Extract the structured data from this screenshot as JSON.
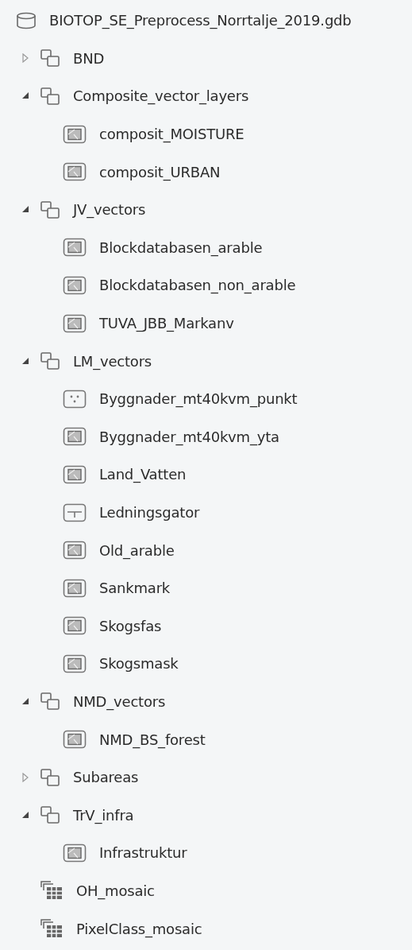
{
  "tree": [
    {
      "label": "BIOTOP_SE_Preprocess_Norrtalje_2019.gdb",
      "kind": "geodatabase",
      "children": [
        {
          "label": "BND",
          "kind": "dataset",
          "expanded": false
        },
        {
          "label": "Composite_vector_layers",
          "kind": "dataset",
          "expanded": true,
          "children": [
            {
              "label": "composit_MOISTURE",
              "kind": "polygon"
            },
            {
              "label": "composit_URBAN",
              "kind": "polygon"
            }
          ]
        },
        {
          "label": "JV_vectors",
          "kind": "dataset",
          "expanded": true,
          "children": [
            {
              "label": "Blockdatabasen_arable",
              "kind": "polygon"
            },
            {
              "label": "Blockdatabasen_non_arable",
              "kind": "polygon"
            },
            {
              "label": "TUVA_JBB_Markanv",
              "kind": "polygon"
            }
          ]
        },
        {
          "label": "LM_vectors",
          "kind": "dataset",
          "expanded": true,
          "children": [
            {
              "label": "Byggnader_mt40kvm_punkt",
              "kind": "point"
            },
            {
              "label": "Byggnader_mt40kvm_yta",
              "kind": "polygon"
            },
            {
              "label": "Land_Vatten",
              "kind": "polygon"
            },
            {
              "label": "Ledningsgator",
              "kind": "line"
            },
            {
              "label": "Old_arable",
              "kind": "polygon"
            },
            {
              "label": "Sankmark",
              "kind": "polygon"
            },
            {
              "label": "Skogsfas",
              "kind": "polygon"
            },
            {
              "label": "Skogsmask",
              "kind": "polygon"
            }
          ]
        },
        {
          "label": "NMD_vectors",
          "kind": "dataset",
          "expanded": true,
          "children": [
            {
              "label": "NMD_BS_forest",
              "kind": "polygon"
            }
          ]
        },
        {
          "label": "Subareas",
          "kind": "dataset",
          "expanded": false
        },
        {
          "label": "TrV_infra",
          "kind": "dataset",
          "expanded": true,
          "children": [
            {
              "label": "Infrastruktur",
              "kind": "polygon"
            }
          ]
        },
        {
          "label": "OH_mosaic",
          "kind": "mosaic"
        },
        {
          "label": "PixelClass_mosaic",
          "kind": "mosaic"
        }
      ]
    }
  ]
}
